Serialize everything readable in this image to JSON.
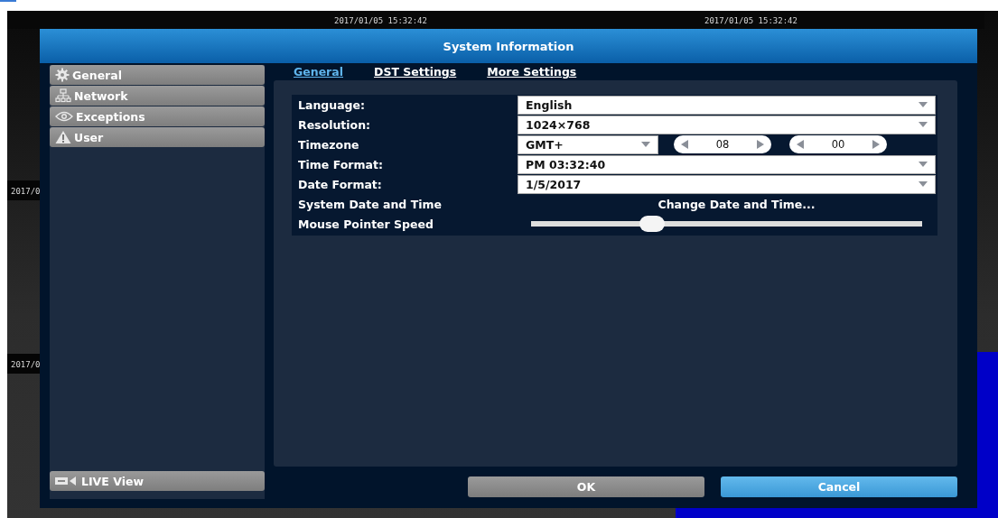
{
  "background": {
    "timestamps": [
      "2017/01/05 15:32:42",
      "2017/01/05 15:32:42",
      "2017/0",
      "2017/0"
    ]
  },
  "dialog": {
    "title": "System Information",
    "sidebar": {
      "items": [
        {
          "label": "General"
        },
        {
          "label": "Network"
        },
        {
          "label": "Exceptions"
        },
        {
          "label": "User"
        }
      ],
      "live_view": "LIVE View"
    },
    "tabs": [
      {
        "label": "General",
        "selected": true
      },
      {
        "label": "DST Settings",
        "selected": false
      },
      {
        "label": "More Settings",
        "selected": false
      }
    ],
    "fields": [
      {
        "kind": "select",
        "label": "Language:",
        "value": "English"
      },
      {
        "kind": "select",
        "label": "Resolution:",
        "value": "1024×768"
      },
      {
        "kind": "timezone",
        "label": "Timezone",
        "value": "GMT+",
        "hours": "08",
        "minutes": "00"
      },
      {
        "kind": "select",
        "label": "Time Format:",
        "value": "PM 03:32:40"
      },
      {
        "kind": "select",
        "label": "Date Format:",
        "value": "1/5/2017"
      },
      {
        "kind": "link",
        "label": "System Date and Time",
        "value": "Change Date and Time..."
      },
      {
        "kind": "slider",
        "label": "Mouse Pointer Speed",
        "level": 0.31
      }
    ],
    "buttons": [
      {
        "label": "OK",
        "kind": "default"
      },
      {
        "label": "Cancel",
        "kind": "primary"
      }
    ]
  }
}
